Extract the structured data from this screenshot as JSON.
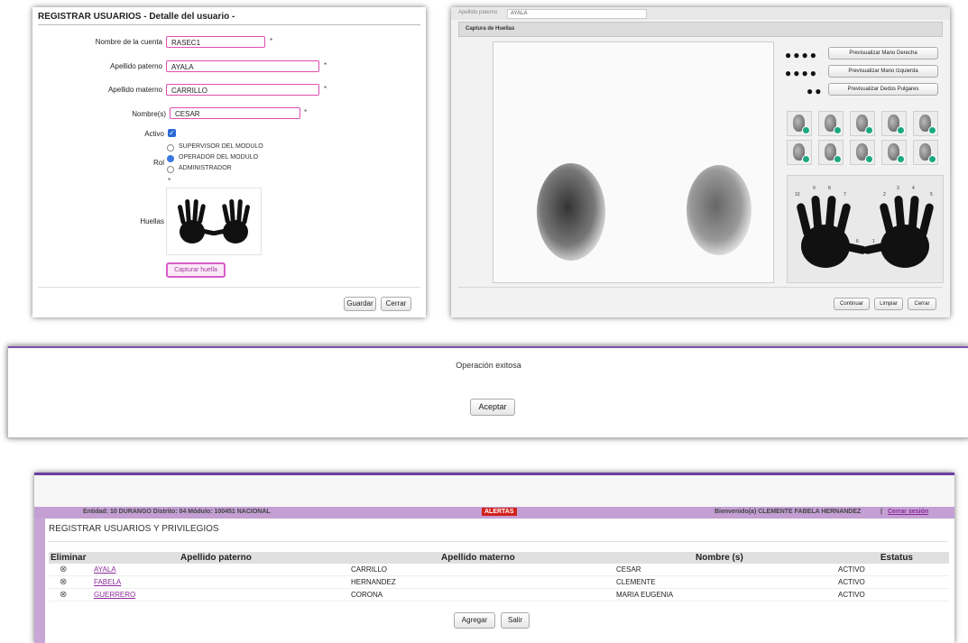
{
  "detail": {
    "title": "REGISTRAR USUARIOS - Detalle del usuario -",
    "labels": {
      "account": "Nombre de la cuenta",
      "paterno": "Apellido paterno",
      "materno": "Apellido materno",
      "nombre": "Nombre(s)",
      "activo": "Activo",
      "rol": "Rol",
      "huellas": "Huellas"
    },
    "values": {
      "account": "RASEC1",
      "paterno": "AYALA",
      "materno": "CARRILLO",
      "nombre": "CESAR"
    },
    "required_mark": "*",
    "check_mark": "✓",
    "roles": [
      "SUPERVISOR DEL MODULO",
      "OPERADOR DEL MODULO",
      "ADMINISTRADOR"
    ],
    "selected_role": "OPERADOR DEL MODULO",
    "capture_button": "Capturar huella",
    "save_button": "Guardar",
    "close_button": "Cerrar"
  },
  "capture": {
    "tab_field_label": "Apellido paterno",
    "tab_field_value": "AYALA",
    "dialog_title": "Captura de Huellas",
    "preview_buttons": [
      "Previsualizar Mano Derecha",
      "Previsualizar Mano Izquierda",
      "Previsualizar Dedos Pulgares"
    ],
    "continue_button": "Continuar",
    "clear_button": "Limpiar",
    "close_button": "Cerrar",
    "finger_numbers": [
      "10",
      "9",
      "8",
      "7",
      "6",
      "1",
      "2",
      "3",
      "4",
      "5"
    ]
  },
  "message": {
    "text": "Operación exitosa",
    "accept_button": "Aceptar"
  },
  "users": {
    "header_left": "Entidad: 10 DURANGO Distrito: 04 Módulo: 100451 NACIONAL",
    "alerts": "ALERTAS",
    "welcome": "Bienvenido(a) CLEMENTE FABELA HERNANDEZ",
    "separator": "|",
    "logout": "Cerrar sesión",
    "section_title": "REGISTRAR USUARIOS Y PRIVILEGIOS",
    "columns": [
      "Eliminar",
      "Apellido paterno",
      "Apellido materno",
      "Nombre (s)",
      "Estatus"
    ],
    "delete_glyph": "⊗",
    "rows": [
      {
        "paterno": "AYALA",
        "materno": "CARRILLO",
        "nombre": "CESAR",
        "estatus": "ACTIVO"
      },
      {
        "paterno": "FABELA",
        "materno": "HERNANDEZ",
        "nombre": "CLEMENTE",
        "estatus": "ACTIVO"
      },
      {
        "paterno": "GUERRERO",
        "materno": "CORONA",
        "nombre": "MARIA EUGENIA",
        "estatus": "ACTIVO"
      }
    ],
    "add_button": "Agregar",
    "exit_button": "Salir"
  },
  "colors": {
    "accent_purple": "#6b3fa0",
    "pink_border": "#e24db0",
    "link_purple": "#8e2c9c",
    "alert_red": "#d0211b"
  }
}
